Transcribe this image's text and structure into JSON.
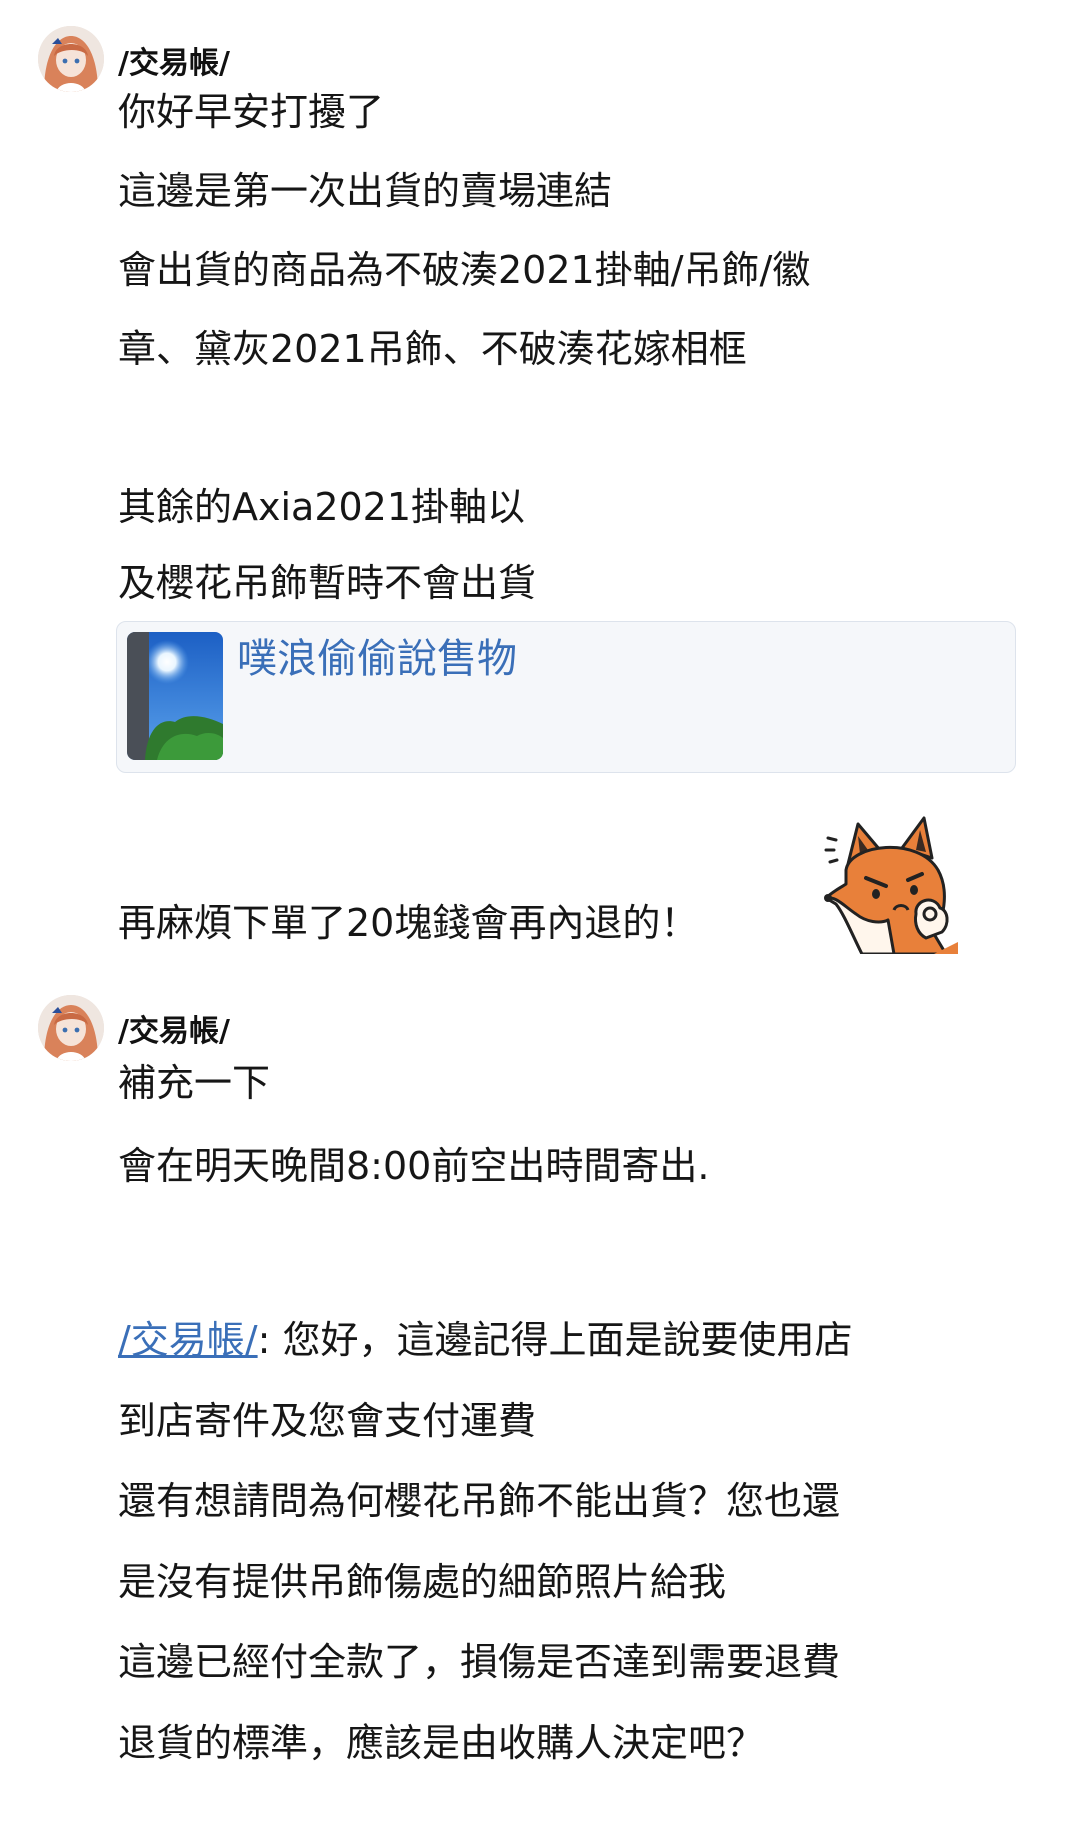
{
  "messages": [
    {
      "author": "/交易帳/",
      "lines": [
        "你好早安打擾了",
        "這邊是第一次出貨的賣場連結",
        "會出貨的商品為不破湊2021掛軸/吊飾/徽",
        "章、黛灰2021吊飾、不破湊花嫁相框",
        "其餘的Axia2021掛軸以",
        "及櫻花吊飾暫時不會出貨"
      ],
      "link_card": {
        "title": "噗浪偷偷說售物"
      },
      "after_link": "再麻煩下單了20塊錢會再內退的！",
      "sticker_icon": "fox-sticker-icon"
    },
    {
      "author": "/交易帳/",
      "lines": [
        "補充一下",
        "會在明天晚間8:00前空出時間寄出."
      ]
    }
  ],
  "reply": {
    "mention": "/交易帳/",
    "first_line_rest": ": 您好，這邊記得上面是說要使用店",
    "lines": [
      "到店寄件及您會支付運費",
      "還有想請問為何櫻花吊飾不能出貨？您也還",
      "是沒有提供吊飾傷處的細節照片給我",
      "這邊已經付全款了，損傷是否達到需要退費",
      "退貨的標準，應該是由收購人決定吧？"
    ]
  },
  "colors": {
    "link": "#3a6fb8",
    "text": "#161616",
    "card_bg": "#f5f7fa"
  }
}
